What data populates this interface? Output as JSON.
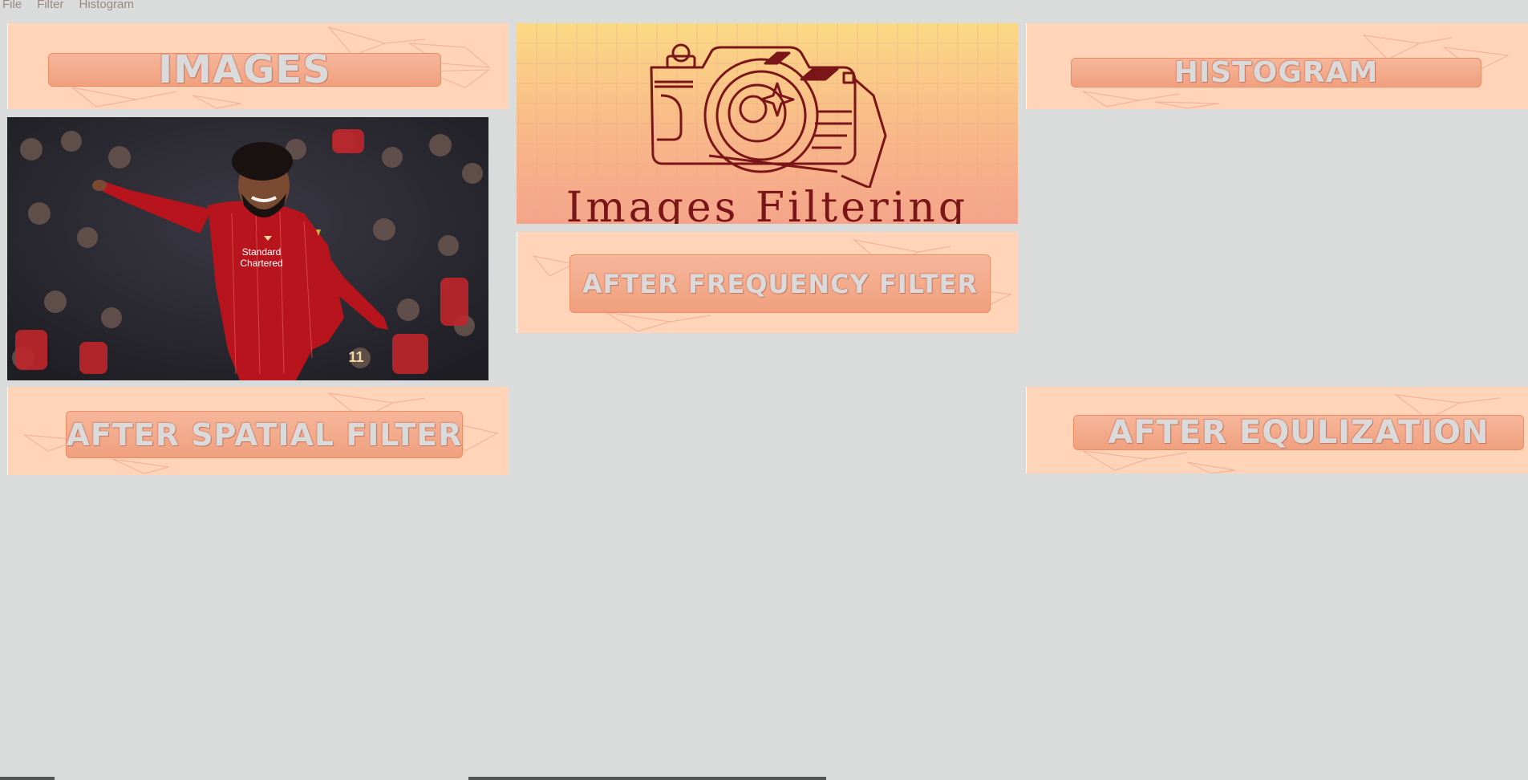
{
  "menu": {
    "file": "File",
    "filter": "Filter",
    "histogram": "Histogram"
  },
  "panels": {
    "images": "IMAGES",
    "histogram": "HISTOGRAM",
    "after_frequency": "AFTER FREQUENCY FILTER",
    "after_spatial": "AFTER SPATIAL FILTER",
    "after_equalization": "AFTER EQULIZATION"
  },
  "banner": {
    "title": "Images Filtering"
  },
  "photo": {
    "shirt_text_1": "Standard",
    "shirt_text_2": "Chartered",
    "number": "11"
  },
  "colors": {
    "panel_bg": "#ffd4b8",
    "label_fill": "#f0a07e",
    "label_border": "#ec8c64",
    "window_bg": "#dadbdb",
    "camera": "#7a1518"
  }
}
